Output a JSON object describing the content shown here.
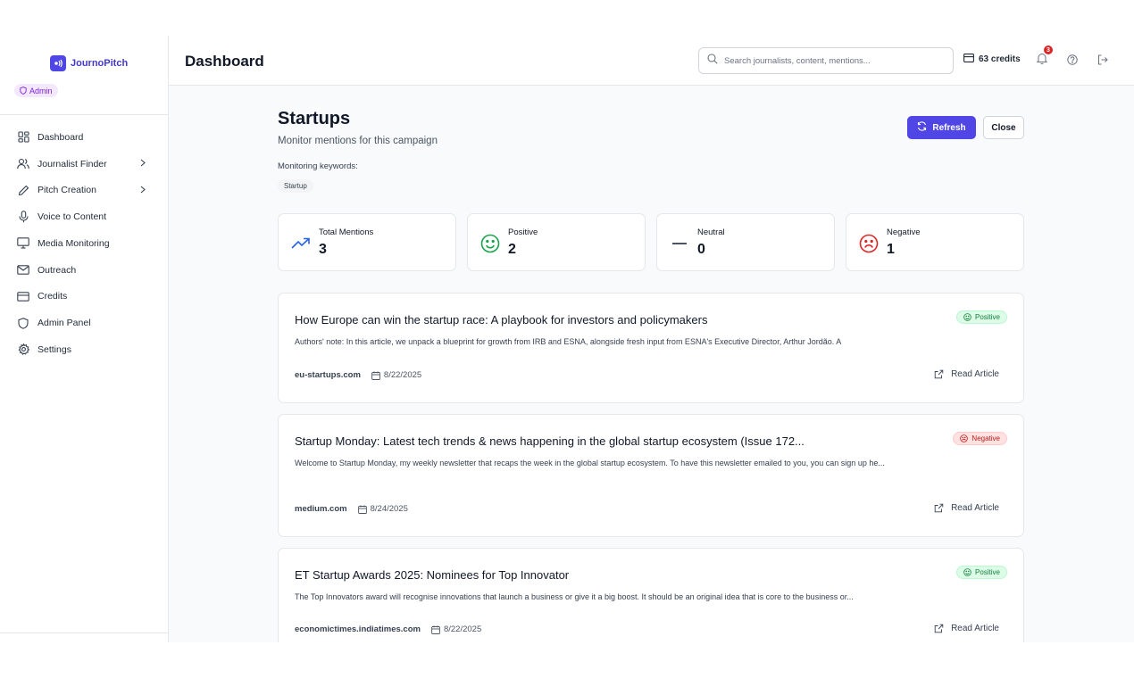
{
  "brand": {
    "name": "JournoPitch",
    "role_badge": "Admin"
  },
  "sidebar": {
    "items": [
      {
        "label": "Dashboard",
        "icon": "grid-icon"
      },
      {
        "label": "Journalist Finder",
        "icon": "users-icon",
        "has_submenu": true
      },
      {
        "label": "Pitch Creation",
        "icon": "pen-icon",
        "has_submenu": true
      },
      {
        "label": "Voice to Content",
        "icon": "microphone-icon"
      },
      {
        "label": "Media Monitoring",
        "icon": "monitor-icon"
      },
      {
        "label": "Outreach",
        "icon": "mail-icon"
      },
      {
        "label": "Credits",
        "icon": "credit-card-icon"
      },
      {
        "label": "Admin Panel",
        "icon": "shield-icon"
      },
      {
        "label": "Settings",
        "icon": "gear-icon"
      }
    ]
  },
  "header": {
    "title": "Dashboard",
    "search_placeholder": "Search journalists, content, mentions...",
    "credits": "63 credits",
    "notification_count": "3"
  },
  "campaign": {
    "title": "Startups",
    "subtitle": "Monitor mentions for this campaign",
    "keywords_label": "Monitoring keywords:",
    "keywords": [
      "Startup"
    ],
    "refresh_label": "Refresh",
    "close_label": "Close"
  },
  "stats": [
    {
      "label": "Total Mentions",
      "value": "3",
      "icon": "trending-up-icon",
      "color": "#2563eb"
    },
    {
      "label": "Positive",
      "value": "2",
      "icon": "smile-icon",
      "color": "#16a34a"
    },
    {
      "label": "Neutral",
      "value": "0",
      "icon": "minus-icon",
      "color": "#374151"
    },
    {
      "label": "Negative",
      "value": "1",
      "icon": "frown-icon",
      "color": "#dc2626"
    }
  ],
  "articles": [
    {
      "title": "How Europe can win the startup race: A playbook for investors and policymakers",
      "snippet": "Authors' note: In this article, we unpack a blueprint for growth from IRB and ESNA, alongside fresh input from ESNA's Executive Director, Arthur Jordão. A",
      "sentiment": "Positive",
      "source": "eu-startups.com",
      "date": "8/22/2025",
      "read_label": "Read Article"
    },
    {
      "title": "Startup Monday: Latest tech trends & news happening in the global startup ecosystem (Issue 172...",
      "snippet": "Welcome to Startup Monday, my weekly newsletter that recaps the week in the global startup ecosystem. To have this newsletter emailed to you, you can sign up he...",
      "sentiment": "Negative",
      "source": "medium.com",
      "date": "8/24/2025",
      "read_label": "Read Article"
    },
    {
      "title": "ET Startup Awards 2025: Nominees for Top Innovator",
      "snippet": "The Top Innovators award will recognise innovations that launch a business or give it a big boost. It should be an original idea that is core to the business or...",
      "sentiment": "Positive",
      "source": "economictimes.indiatimes.com",
      "date": "8/22/2025",
      "read_label": "Read Article"
    }
  ],
  "colors": {
    "accent": "#4f46e5",
    "positive": "#16a34a",
    "negative": "#dc2626"
  }
}
